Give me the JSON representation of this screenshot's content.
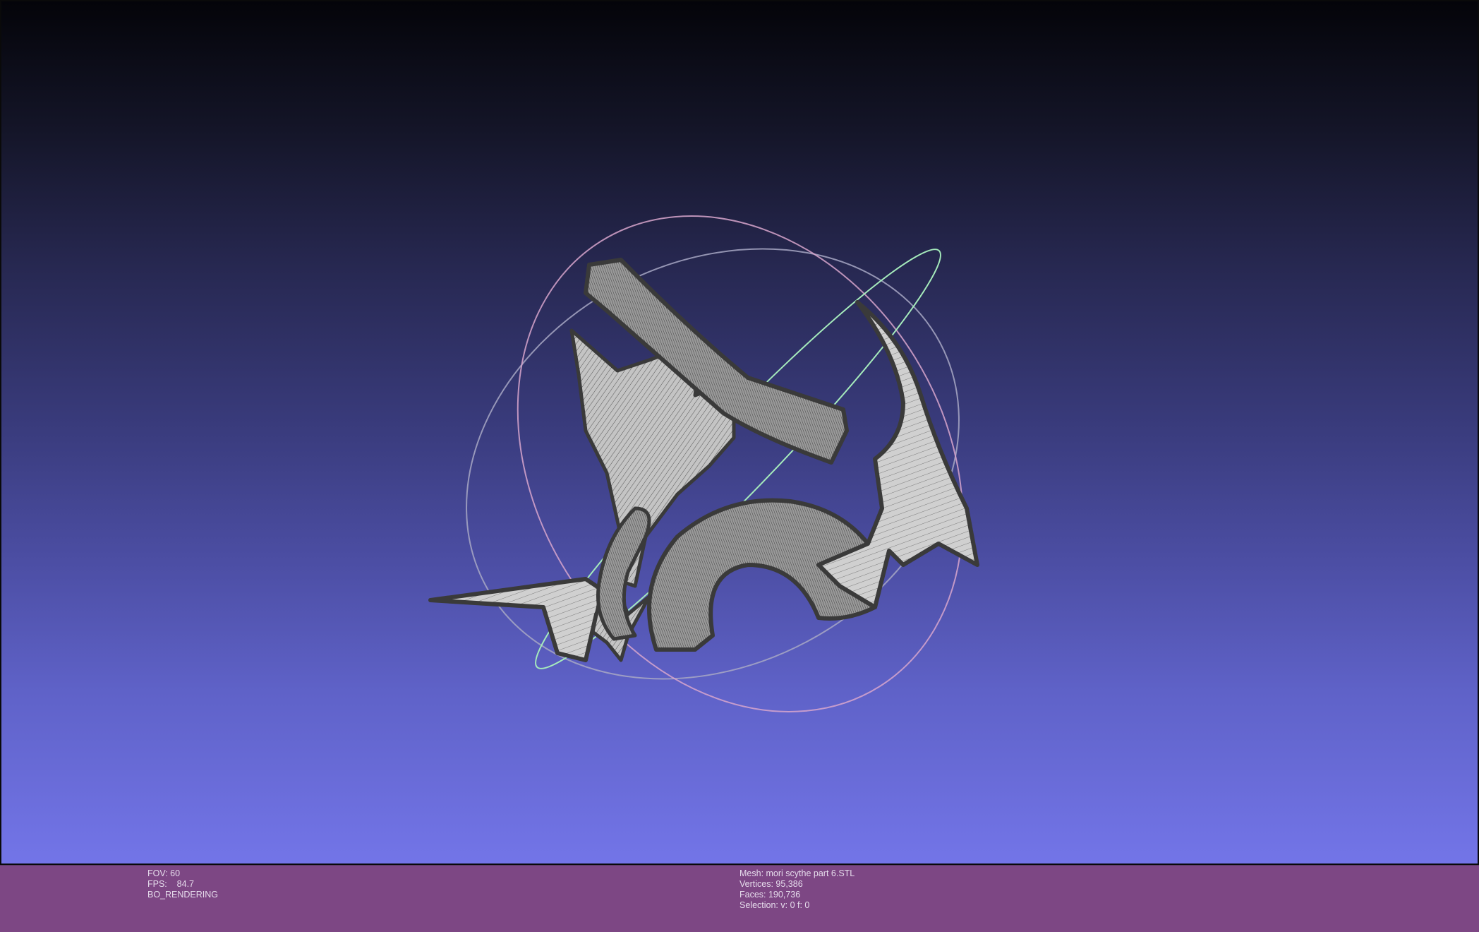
{
  "status_left": {
    "fov": "FOV: 60",
    "fps": "FPS:    84.7",
    "mode": "BO_RENDERING"
  },
  "status_right": {
    "mesh": "Mesh: mori scythe part 6.STL",
    "vertices": "Vertices: 95,386",
    "faces": "Faces: 190,736",
    "selection": "Selection: v: 0 f: 0"
  },
  "colors": {
    "status_bar": "#7d4784",
    "background_top": "#040409",
    "background_bottom": "#7375e8",
    "mesh_fill": "#b8b8b8",
    "mesh_edge": "#3a3a3a",
    "trackball_green": "#9ee6b4",
    "trackball_pink": "#e6a0c0",
    "trackball_gray": "#a0a0b8"
  }
}
